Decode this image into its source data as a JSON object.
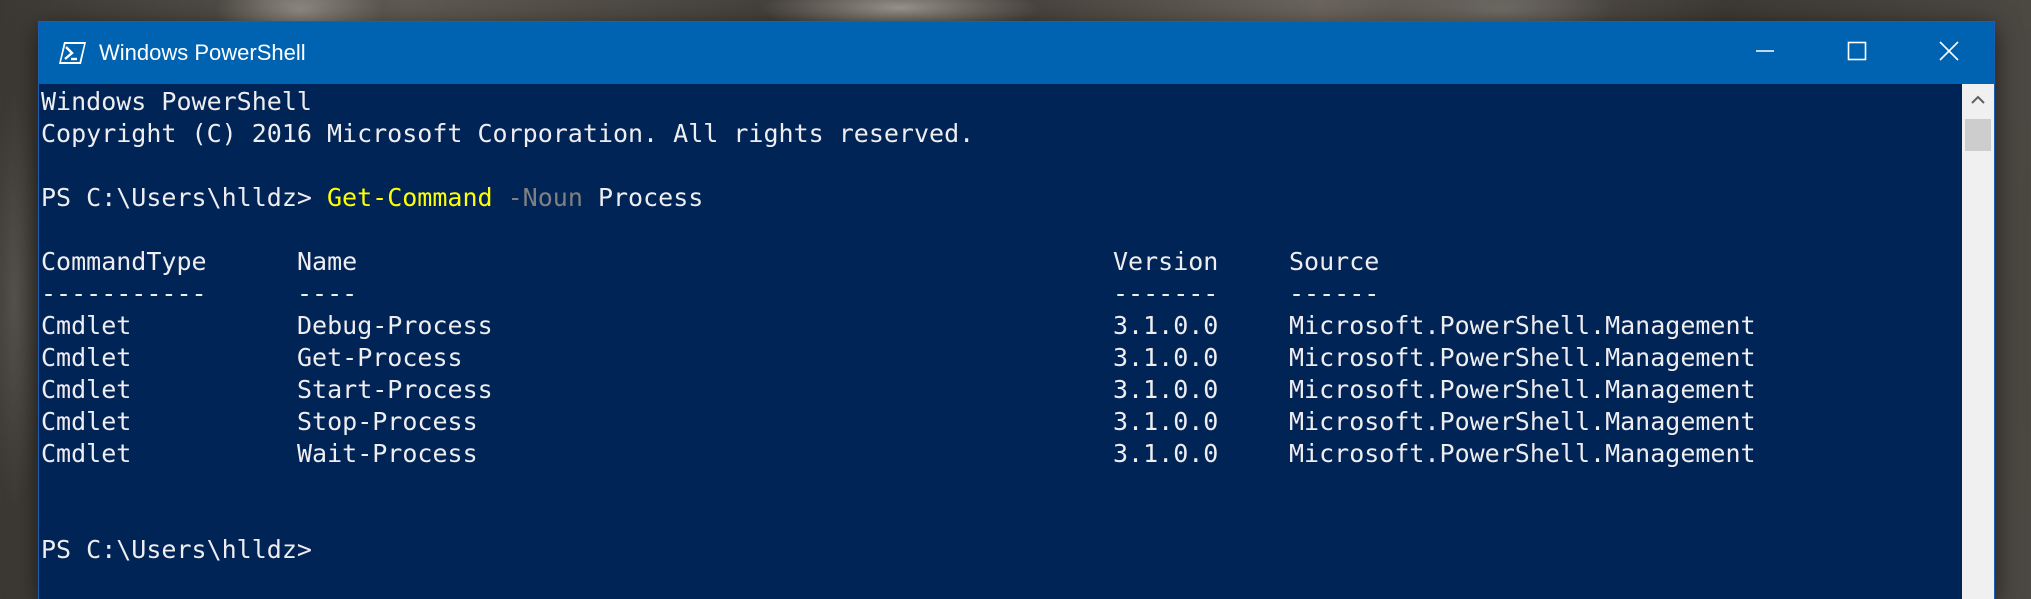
{
  "window": {
    "title": "Windows PowerShell",
    "colors": {
      "titlebar": "#0063b1",
      "console_bg": "#012456",
      "text": "#eeedf0",
      "command": "#ffff00",
      "parameter": "#808080"
    }
  },
  "icons": {
    "app": "powershell-icon",
    "minimize": "minimize-icon",
    "maximize": "maximize-icon",
    "close": "close-icon",
    "scroll_up": "chevron-up-icon"
  },
  "console": {
    "banner_title": "Windows PowerShell",
    "copyright": "Copyright (C) 2016 Microsoft Corporation. All rights reserved.",
    "prompt1": "PS C:\\Users\\hlldz> ",
    "command": "Get-Command",
    "parameter": "-Noun",
    "argument": "Process",
    "prompt2": "PS C:\\Users\\hlldz>",
    "table": {
      "headers": [
        "CommandType",
        "Name",
        "Version",
        "Source"
      ],
      "separators": [
        "-----------",
        "----",
        "-------",
        "------"
      ],
      "rows": [
        [
          "Cmdlet",
          "Debug-Process",
          "3.1.0.0",
          "Microsoft.PowerShell.Management"
        ],
        [
          "Cmdlet",
          "Get-Process",
          "3.1.0.0",
          "Microsoft.PowerShell.Management"
        ],
        [
          "Cmdlet",
          "Start-Process",
          "3.1.0.0",
          "Microsoft.PowerShell.Management"
        ],
        [
          "Cmdlet",
          "Stop-Process",
          "3.1.0.0",
          "Microsoft.PowerShell.Management"
        ],
        [
          "Cmdlet",
          "Wait-Process",
          "3.1.0.0",
          "Microsoft.PowerShell.Management"
        ]
      ]
    }
  }
}
